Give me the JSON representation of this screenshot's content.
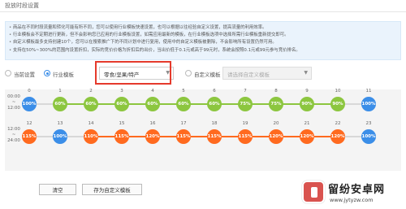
{
  "page": {
    "title": "投放时段设置"
  },
  "notice": {
    "lines": [
      "商品在不同时段流量和转化可能有所不同，您可以使用行业模板快速设置，也可以根据以往经验自定义设置，提高流量的利用效率。",
      "行业模板会不定期进行更新，但不会影响您已应用的行业模板设置，如需应用最新的模板，在行业模板选项中选择所需行业模板重新提交即可。",
      "自定义模板最多支持创建10个，您可以在搜索推广下的不同计划中进行复用，使用中的自定义模板被删除，不会影响所有设置仍然可用。",
      "支持在50%~300%的范围内设置折扣，实际的竞价价格为折扣后的出价，当出价低于0.1元或高于99元时，系统会按照0.1元或99元参与竞价排名。"
    ]
  },
  "mode": {
    "options": [
      {
        "label": "当前设置",
        "selected": false
      },
      {
        "label": "行业模板",
        "selected": true
      },
      {
        "label": "自定义模板",
        "selected": false
      }
    ],
    "industry_select": "零食/坚果/特产",
    "custom_select_placeholder": "请选择自定义模板"
  },
  "schedule": {
    "rows": [
      {
        "time_top": "00:00",
        "time_sep": "~",
        "time_bottom": "12:00",
        "hours": [
          "0",
          "1",
          "2",
          "3",
          "4",
          "5",
          "6",
          "7",
          "8",
          "9",
          "10",
          "11"
        ],
        "values": [
          "100%",
          "60%",
          "60%",
          "60%",
          "60%",
          "60%",
          "60%",
          "75%",
          "75%",
          "90%",
          "90%",
          "100%"
        ]
      },
      {
        "time_top": "12:00",
        "time_sep": "~",
        "time_bottom": "24:00",
        "hours": [
          "12",
          "13",
          "14",
          "15",
          "16",
          "17",
          "18",
          "19",
          "20",
          "21",
          "22",
          "23"
        ],
        "values": [
          "115%",
          "100%",
          "110%",
          "115%",
          "120%",
          "115%",
          "115%",
          "115%",
          "120%",
          "120%",
          "120%",
          "100%"
        ]
      }
    ]
  },
  "actions": {
    "clear": "清空",
    "save_template": "存为自定义模板"
  },
  "watermark": {
    "text": "留纷安卓网",
    "url": "www.jytyzw.com"
  },
  "colors": {
    "green": "#8cc63f",
    "orange": "#ff6a1f",
    "blue": "#3b8ee8",
    "accent": "#3b8ee8",
    "highlight": "#e53a2c"
  }
}
